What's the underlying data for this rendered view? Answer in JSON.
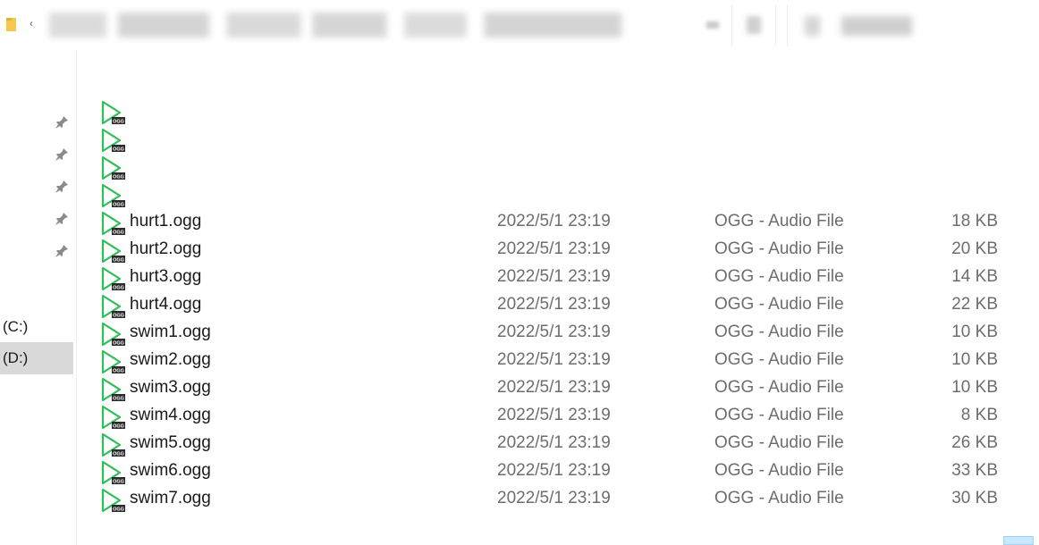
{
  "window": {
    "address_icon": "folder-icon",
    "back_icon": "chevron-left-icon",
    "address_chevron": "‹"
  },
  "nav": {
    "pins": [
      {
        "icon": "pin-icon"
      },
      {
        "icon": "pin-icon"
      },
      {
        "icon": "pin-icon"
      },
      {
        "icon": "pin-icon"
      },
      {
        "icon": "pin-icon"
      }
    ],
    "drives": [
      {
        "label": "(C:)",
        "selected": false
      },
      {
        "label": "(D:)",
        "selected": true
      }
    ]
  },
  "file_list": {
    "icon": "ogg-audio-file-icon",
    "icon_badge": "OGG",
    "rows": [
      {
        "name": "",
        "date": "",
        "type": "",
        "size": ""
      },
      {
        "name": "",
        "date": "",
        "type": "",
        "size": ""
      },
      {
        "name": "",
        "date": "",
        "type": "",
        "size": ""
      },
      {
        "name": "",
        "date": "",
        "type": "",
        "size": ""
      },
      {
        "name": "hurt1.ogg",
        "date": "2022/5/1 23:19",
        "type": "OGG - Audio File",
        "size": "18 KB"
      },
      {
        "name": "hurt2.ogg",
        "date": "2022/5/1 23:19",
        "type": "OGG - Audio File",
        "size": "20 KB"
      },
      {
        "name": "hurt3.ogg",
        "date": "2022/5/1 23:19",
        "type": "OGG - Audio File",
        "size": "14 KB"
      },
      {
        "name": "hurt4.ogg",
        "date": "2022/5/1 23:19",
        "type": "OGG - Audio File",
        "size": "22 KB"
      },
      {
        "name": "swim1.ogg",
        "date": "2022/5/1 23:19",
        "type": "OGG - Audio File",
        "size": "10 KB"
      },
      {
        "name": "swim2.ogg",
        "date": "2022/5/1 23:19",
        "type": "OGG - Audio File",
        "size": "10 KB"
      },
      {
        "name": "swim3.ogg",
        "date": "2022/5/1 23:19",
        "type": "OGG - Audio File",
        "size": "10 KB"
      },
      {
        "name": "swim4.ogg",
        "date": "2022/5/1 23:19",
        "type": "OGG - Audio File",
        "size": "8 KB"
      },
      {
        "name": "swim5.ogg",
        "date": "2022/5/1 23:19",
        "type": "OGG - Audio File",
        "size": "26 KB"
      },
      {
        "name": "swim6.ogg",
        "date": "2022/5/1 23:19",
        "type": "OGG - Audio File",
        "size": "33 KB"
      },
      {
        "name": "swim7.ogg",
        "date": "2022/5/1 23:19",
        "type": "OGG - Audio File",
        "size": "30 KB"
      }
    ]
  },
  "colors": {
    "play_icon": "#2fbf5a",
    "selected_bg": "#d9d9d9",
    "secondary_text": "#6d6d6d"
  }
}
